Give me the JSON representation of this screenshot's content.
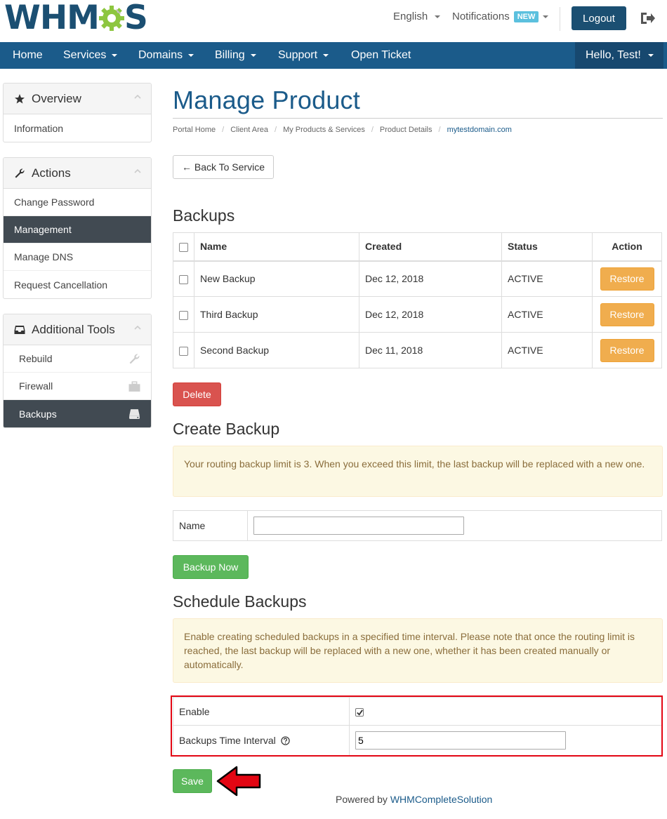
{
  "header": {
    "logo_text_left": "WHM",
    "logo_text_right": "S",
    "language": "English",
    "notifications": "Notifications",
    "notifications_badge": "NEW",
    "logout": "Logout"
  },
  "nav": {
    "items": [
      {
        "label": "Home",
        "dropdown": false
      },
      {
        "label": "Services",
        "dropdown": true
      },
      {
        "label": "Domains",
        "dropdown": true
      },
      {
        "label": "Billing",
        "dropdown": true
      },
      {
        "label": "Support",
        "dropdown": true
      },
      {
        "label": "Open Ticket",
        "dropdown": false
      }
    ],
    "user": "Hello, Test!"
  },
  "sidebar": {
    "overview": {
      "title": "Overview",
      "items": [
        "Information"
      ]
    },
    "actions": {
      "title": "Actions",
      "items": [
        "Change Password",
        "Management",
        "Manage DNS",
        "Request Cancellation"
      ],
      "active": "Management"
    },
    "tools": {
      "title": "Additional Tools",
      "items": [
        "Rebuild",
        "Firewall",
        "Backups"
      ],
      "active": "Backups"
    }
  },
  "page": {
    "title": "Manage Product",
    "breadcrumb": [
      "Portal Home",
      "Client Area",
      "My Products & Services",
      "Product Details",
      "mytestdomain.com"
    ],
    "back_button": "← Back To Service"
  },
  "backups": {
    "heading": "Backups",
    "columns": [
      "Name",
      "Created",
      "Status",
      "Action"
    ],
    "rows": [
      {
        "name": "New Backup",
        "created": "Dec 12, 2018",
        "status": "ACTIVE",
        "action": "Restore"
      },
      {
        "name": "Third Backup",
        "created": "Dec 12, 2018",
        "status": "ACTIVE",
        "action": "Restore"
      },
      {
        "name": "Second Backup",
        "created": "Dec 11, 2018",
        "status": "ACTIVE",
        "action": "Restore"
      }
    ],
    "delete_button": "Delete"
  },
  "create_backup": {
    "heading": "Create Backup",
    "alert": "Your routing backup limit is 3. When you exceed this limit, the last backup will be replaced with a new one.",
    "name_label": "Name",
    "name_value": "",
    "button": "Backup Now"
  },
  "schedule": {
    "heading": "Schedule Backups",
    "alert": "Enable creating scheduled backups in a specified time interval. Please note that once the routing limit is reached, the last backup will be replaced with a new one, whether it has been created manually or automatically.",
    "enable_label": "Enable",
    "enable_checked": true,
    "interval_label": "Backups Time Interval",
    "interval_value": "5",
    "save_button": "Save"
  },
  "footer": {
    "powered_by": "Powered by",
    "link": "WHMCompleteSolution"
  },
  "colors": {
    "brand": "#1b5b8a",
    "success": "#5cb85c",
    "warning": "#f0ad4e",
    "danger": "#d9534f",
    "highlight": "#e30613"
  },
  "icons": [
    "gear-logo-icon",
    "exit-icon",
    "star-icon",
    "wrench-icon",
    "inbox-icon",
    "chevron-up-icon",
    "firewall-icon",
    "hdd-icon",
    "help-icon",
    "arrow-left-icon"
  ]
}
